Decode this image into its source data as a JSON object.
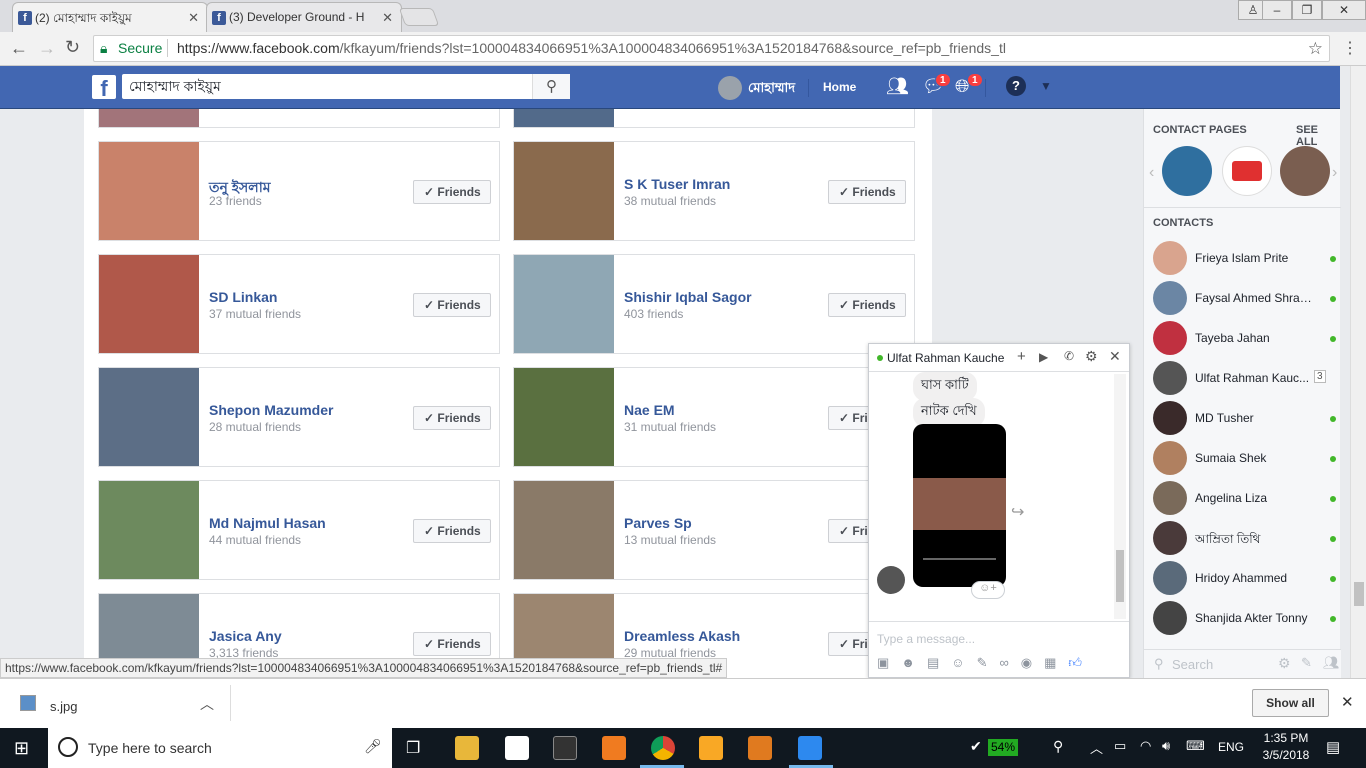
{
  "browser": {
    "tabs": [
      {
        "title": "(2) মোহাম্মাদ কাইয়ুম",
        "active": true
      },
      {
        "title": "(3) Developer Ground - H",
        "active": false
      }
    ],
    "secure_label": "Secure",
    "url_host": "https://www.facebook.com",
    "url_path": "/kfkayum/friends?lst=100004834066951%3A100004834066951%3A1520184768&source_ref=pb_friends_tl",
    "status_url": "https://www.facebook.com/kfkayum/friends?lst=100004834066951%3A100004834066951%3A1520184768&source_ref=pb_friends_tl#"
  },
  "fb_header": {
    "search_value": "মোহাম্মাদ কাইয়ুম",
    "profile_name": "মোহাম্মাদ",
    "home_label": "Home",
    "messages_badge": "1",
    "notifications_badge": "1",
    "brand_color": "#4267b2"
  },
  "friends": {
    "button_label": "Friends",
    "button_label_cut": "Frie",
    "rows": [
      [
        {
          "name": "তনু ইসলাম",
          "sub": "23 friends",
          "color": "#c9826a"
        },
        {
          "name": "S K Tuser Imran",
          "sub": "38 mutual friends",
          "color": "#8a6a4d"
        }
      ],
      [
        {
          "name": "SD Linkan",
          "sub": "37 mutual friends",
          "color": "#b0584a"
        },
        {
          "name": "Shishir Iqbal Sagor",
          "sub": "403 friends",
          "color": "#8fa7b4"
        }
      ],
      [
        {
          "name": "Shepon Mazumder",
          "sub": "28 mutual friends",
          "color": "#5c6e86"
        },
        {
          "name": "Nae EM",
          "sub": "31 mutual friends",
          "color": "#5a7040"
        }
      ],
      [
        {
          "name": "Md Najmul Hasan",
          "sub": "44 mutual friends",
          "color": "#6d8a5e"
        },
        {
          "name": "Parves Sp",
          "sub": "13 mutual friends",
          "color": "#8a7a68"
        }
      ],
      [
        {
          "name": "Jasica Any",
          "sub": "3,313 friends",
          "color": "#7e8b95"
        },
        {
          "name": "Dreamless Akash",
          "sub": "29 mutual friends",
          "color": "#9c8670"
        }
      ]
    ]
  },
  "chat": {
    "contact_name": "Ulfat Rahman Kauche",
    "messages": [
      "ঘাস কাটি",
      "নাটক দেখি"
    ],
    "input_placeholder": "Type a message..."
  },
  "sidebar": {
    "contact_pages_label": "CONTACT PAGES",
    "see_all_label": "SEE ALL",
    "contacts_label": "CONTACTS",
    "contacts": [
      {
        "name": "Frieya Islam Prite",
        "online": true
      },
      {
        "name": "Faysal Ahmed Shrabon",
        "online": true
      },
      {
        "name": "Tayeba Jahan",
        "online": true
      },
      {
        "name": "Ulfat Rahman Kauc...",
        "online": false,
        "count": "3"
      },
      {
        "name": "MD Tusher",
        "online": true
      },
      {
        "name": "Sumaia Shek",
        "online": true
      },
      {
        "name": "Angelina Liza",
        "online": true
      },
      {
        "name": "আম্রিতা তিথি",
        "online": true
      },
      {
        "name": "Hridoy Ahammed",
        "online": true
      },
      {
        "name": "Shanjida Akter Tonny",
        "online": true
      }
    ],
    "search_placeholder": "Search"
  },
  "downloads": {
    "file_name": "s.jpg",
    "show_all_label": "Show all"
  },
  "taskbar": {
    "search_placeholder": "Type here to search",
    "battery": "54%",
    "language": "ENG",
    "time": "1:35 PM",
    "date": "3/5/2018"
  }
}
